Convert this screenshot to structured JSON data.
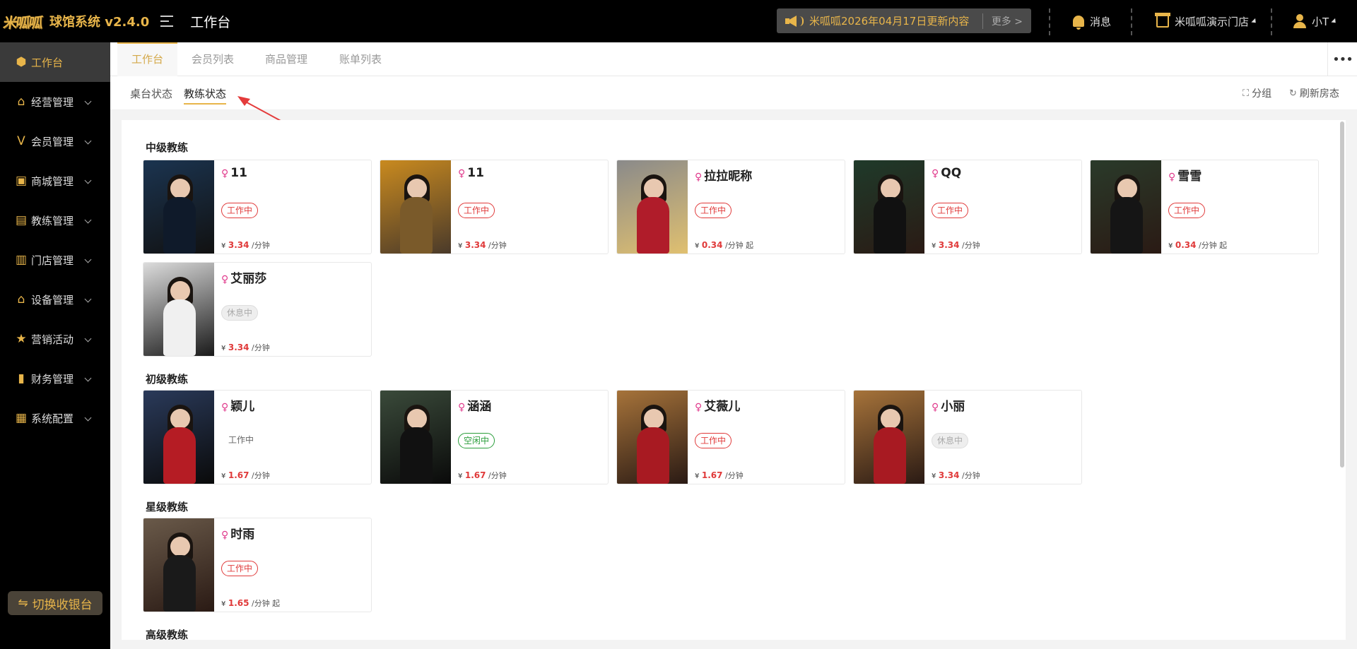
{
  "header": {
    "logo_text": "米呱呱",
    "app_name": "球馆系统 v2.4.0",
    "page_title": "工作台",
    "notice_text": "米呱呱2026年04月17日更新内容",
    "notice_more": "更多 >",
    "messages_label": "消息",
    "store_label": "米呱呱演示门店",
    "user_label": "小T"
  },
  "sidebar": {
    "items": [
      {
        "label": "工作台",
        "icon": "cube-icon"
      },
      {
        "label": "经营管理",
        "icon": "shop-icon"
      },
      {
        "label": "会员管理",
        "icon": "vip-icon"
      },
      {
        "label": "商城管理",
        "icon": "bag-icon"
      },
      {
        "label": "教练管理",
        "icon": "coach-icon"
      },
      {
        "label": "门店管理",
        "icon": "store-icon"
      },
      {
        "label": "设备管理",
        "icon": "device-icon"
      },
      {
        "label": "营销活动",
        "icon": "star-icon"
      },
      {
        "label": "财务管理",
        "icon": "chart-icon"
      },
      {
        "label": "系统配置",
        "icon": "grid-icon"
      }
    ],
    "switch_label": "切换收银台"
  },
  "tabs": [
    "工作台",
    "会员列表",
    "商品管理",
    "账单列表"
  ],
  "subtabs": [
    "桌台状态",
    "教练状态"
  ],
  "actions": {
    "group": "分组",
    "refresh": "刷新房态"
  },
  "groups": [
    {
      "title": "中级教练",
      "coaches": [
        {
          "name": "11",
          "status": "工作中",
          "price": "3.34",
          "unit": "/分钟",
          "photo": "coach-photo"
        },
        {
          "name": "11",
          "status": "工作中",
          "price": "3.34",
          "unit": "/分钟",
          "photo": "coach-photo"
        },
        {
          "name": "拉拉昵称",
          "status": "工作中",
          "price": "0.34",
          "unit": "/分钟 起",
          "photo": "coach-photo"
        },
        {
          "name": "QQ",
          "status": "工作中",
          "price": "3.34",
          "unit": "/分钟",
          "photo": "coach-photo"
        },
        {
          "name": "雪雪",
          "status": "工作中",
          "price": "0.34",
          "unit": "/分钟 起",
          "photo": "coach-photo"
        },
        {
          "name": "艾丽莎",
          "status": "休息中",
          "price": "3.34",
          "unit": "/分钟",
          "photo": "coach-photo"
        }
      ]
    },
    {
      "title": "初级教练",
      "coaches": [
        {
          "name": "颖儿",
          "status": "工作中",
          "price": "1.67",
          "unit": "/分钟",
          "photo": "coach-photo"
        },
        {
          "name": "涵涵",
          "status": "空闲中",
          "price": "1.67",
          "unit": "/分钟",
          "photo": "coach-photo"
        },
        {
          "name": "艾薇儿",
          "status": "工作中",
          "price": "1.67",
          "unit": "/分钟",
          "photo": "coach-photo"
        },
        {
          "name": "小丽",
          "status": "休息中",
          "price": "3.34",
          "unit": "/分钟",
          "photo": "coach-photo"
        }
      ]
    },
    {
      "title": "星级教练",
      "coaches": [
        {
          "name": "时雨",
          "status": "工作中",
          "price": "1.65",
          "unit": "/分钟 起",
          "photo": "coach-photo"
        }
      ]
    },
    {
      "title": "高级教练",
      "coaches": []
    }
  ],
  "currency": "¥",
  "colors": {
    "accent": "#e8b54a",
    "working": "#e03a3a",
    "idle": "#2a9d3a",
    "rest": "#aaaaaa"
  }
}
